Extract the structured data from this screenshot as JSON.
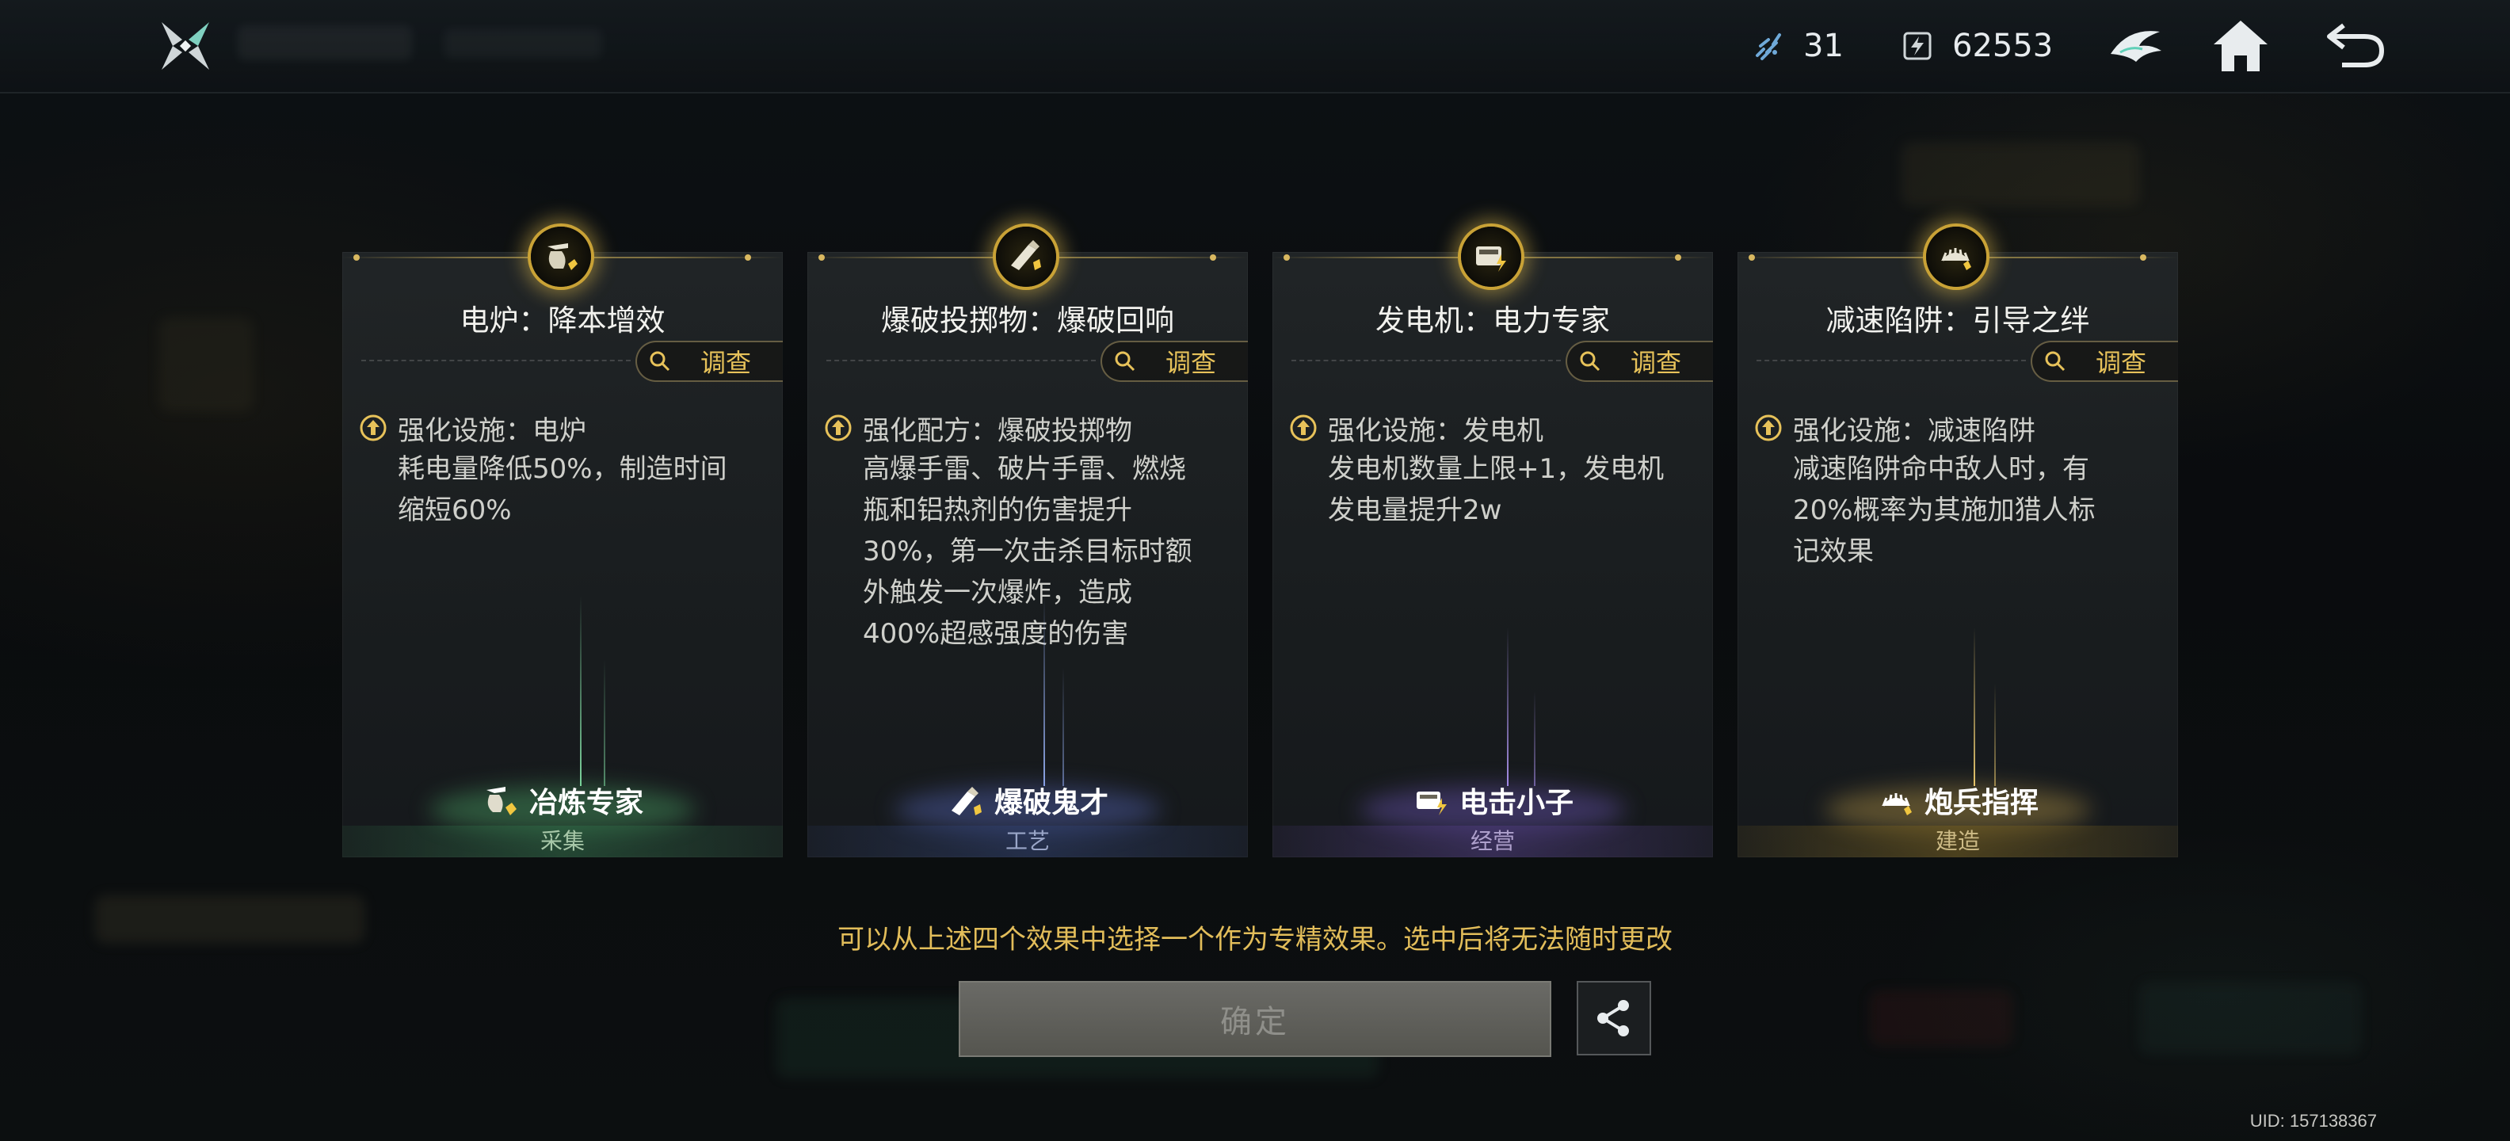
{
  "header": {
    "resources": [
      {
        "icon": "crystal-shard-icon",
        "value": "31"
      },
      {
        "icon": "energy-chip-icon",
        "value": "62553"
      }
    ],
    "buttons": [
      "brand-emblem-icon",
      "home-icon",
      "back-arrow-icon"
    ]
  },
  "cards": [
    {
      "title": "电炉：降本增效",
      "inspect_label": "调查",
      "effect_head": "强化设施：电炉",
      "effect_lines": [
        "耗电量降低50%，制造时间",
        "缩短60%"
      ],
      "specialist": "冶炼专家",
      "category": "采集",
      "accent": "#2f6b46"
    },
    {
      "title": "爆破投掷物：爆破回响",
      "inspect_label": "调查",
      "effect_head": "强化配方：爆破投掷物",
      "effect_lines": [
        "高爆手雷、破片手雷、燃烧",
        "瓶和铝热剂的伤害提升",
        "30%，第一次击杀目标时额",
        "外触发一次爆炸，造成",
        "400%超感强度的伤害"
      ],
      "specialist": "爆破鬼才",
      "category": "工艺",
      "accent": "#30406e"
    },
    {
      "title": "发电机：电力专家",
      "inspect_label": "调查",
      "effect_head": "强化设施：发电机",
      "effect_lines": [
        "发电机数量上限+1，发电机",
        "发电量提升2w"
      ],
      "specialist": "电击小子",
      "category": "经营",
      "accent": "#4b3a78"
    },
    {
      "title": "减速陷阱：引导之绊",
      "inspect_label": "调查",
      "effect_head": "强化设施：减速陷阱",
      "effect_lines": [
        "减速陷阱命中敌人时，有",
        "20%概率为其施加猎人标",
        "记效果"
      ],
      "specialist": "炮兵指挥",
      "category": "建造",
      "accent": "#6e5a20"
    }
  ],
  "notice": "可以从上述四个效果中选择一个作为专精效果。选中后将无法随时更改",
  "confirm_label": "确定",
  "uid": "UID: 157138367"
}
